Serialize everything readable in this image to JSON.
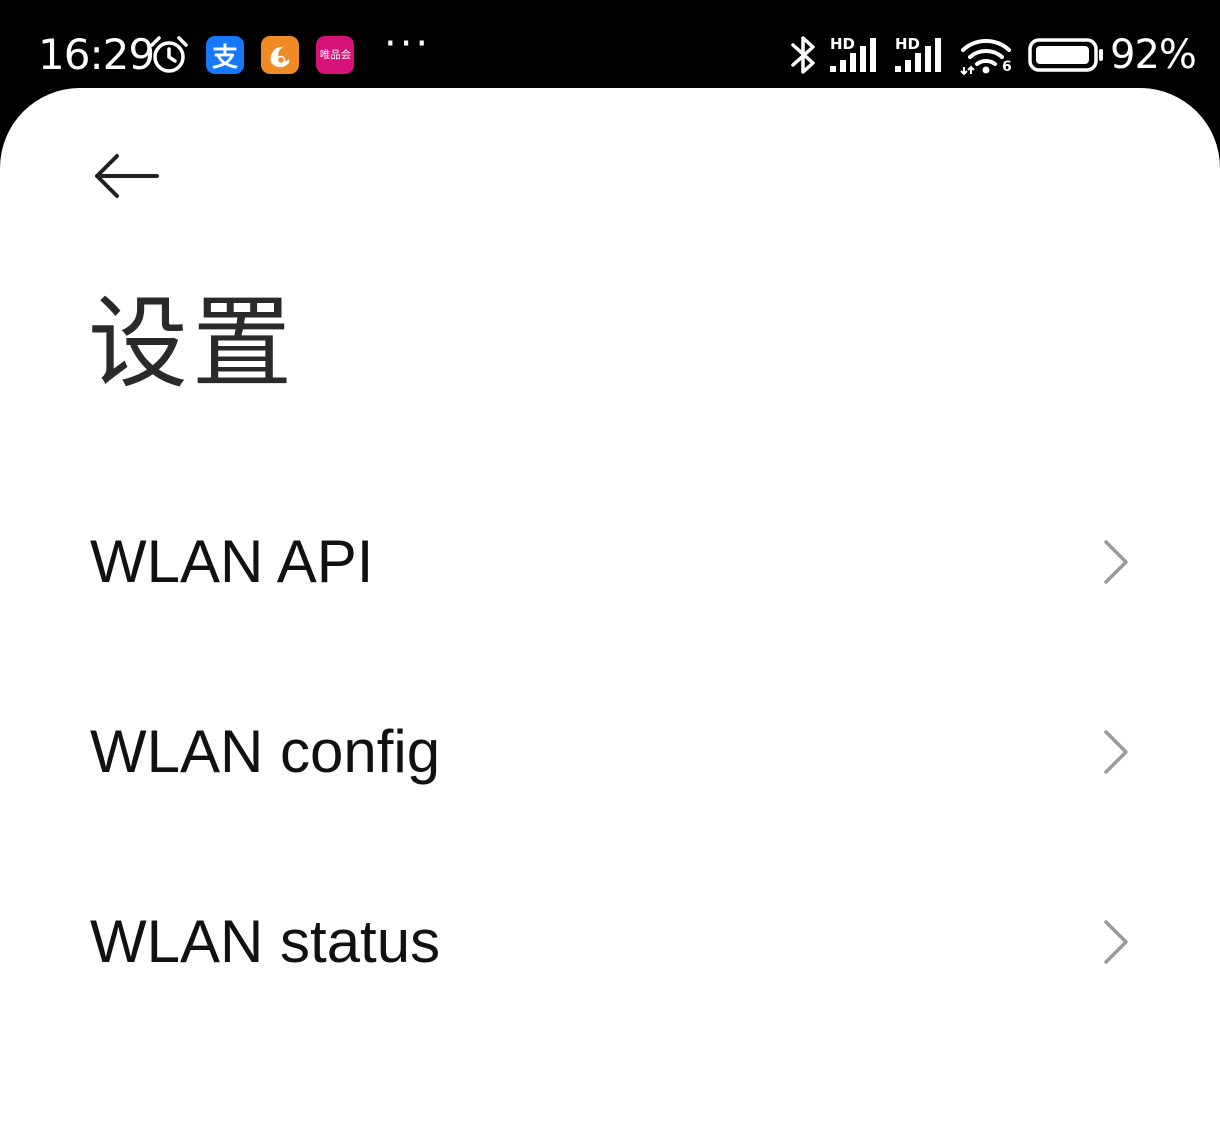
{
  "status_bar": {
    "time": "16:29",
    "icons": [
      "alarm-icon",
      "alipay-app-icon",
      "uc-browser-app-icon",
      "vip-shop-app-icon",
      "more-notifications-icon",
      "bluetooth-icon",
      "signal-sim1-icon",
      "signal-sim2-icon",
      "wifi-6-icon",
      "battery-icon"
    ],
    "alipay_glyph": "支",
    "vipshop_glyph": "唯品会",
    "more": "···",
    "hd_label_1": "HD",
    "hd_label_2": "HD",
    "wifi_version": "6",
    "battery_percent": "92%",
    "battery_level": 0.92
  },
  "header": {
    "back_icon": "arrow-left-icon",
    "title": "设置"
  },
  "settings_list": [
    {
      "label": "WLAN API",
      "icon": "chevron-right-icon"
    },
    {
      "label": "WLAN config",
      "icon": "chevron-right-icon"
    },
    {
      "label": "WLAN status",
      "icon": "chevron-right-icon"
    }
  ],
  "colors": {
    "status_bar_bg": "#000000",
    "sheet_bg": "#ffffff",
    "title_text": "#2a2a2a",
    "item_text": "#111111",
    "chevron": "#9a9a9a",
    "alipay_blue": "#1677ff",
    "uc_orange": "#f08a24",
    "vipshop_pink": "#d6127a"
  }
}
